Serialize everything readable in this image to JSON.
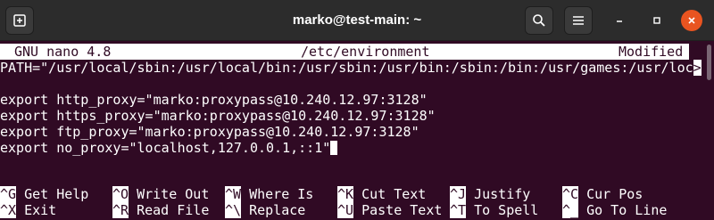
{
  "window": {
    "title": "marko@test-main: ~",
    "accent_close": "#e95420"
  },
  "nano": {
    "version": "GNU nano 4.8",
    "file": "/etc/environment",
    "status": "Modified"
  },
  "lines": {
    "path": "PATH=\"/usr/local/sbin:/usr/local/bin:/usr/sbin:/usr/bin:/sbin:/bin:/usr/games:/usr/loc",
    "path_trunc": ">",
    "http": "export http_proxy=\"marko:proxypass@10.240.12.97:3128\"",
    "https": "export https_proxy=\"marko:proxypass@10.240.12.97:3128\"",
    "ftp": "export ftp_proxy=\"marko:proxypass@10.240.12.97:3128\"",
    "no_proxy": "export no_proxy=\"localhost,127.0.0.1,::1\""
  },
  "shortcuts": [
    {
      "key": "^G",
      "label": " Get Help"
    },
    {
      "key": "^O",
      "label": " Write Out"
    },
    {
      "key": "^W",
      "label": " Where Is"
    },
    {
      "key": "^K",
      "label": " Cut Text"
    },
    {
      "key": "^J",
      "label": " Justify"
    },
    {
      "key": "^C",
      "label": " Cur Pos"
    },
    {
      "key": "^X",
      "label": " Exit"
    },
    {
      "key": "^R",
      "label": " Read File"
    },
    {
      "key": "^\\",
      "label": " Replace"
    },
    {
      "key": "^U",
      "label": " Paste Text"
    },
    {
      "key": "^T",
      "label": " To Spell"
    },
    {
      "key": "^_",
      "label": " Go To Line"
    }
  ]
}
